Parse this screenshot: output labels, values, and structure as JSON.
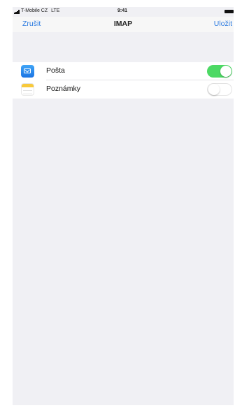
{
  "status_bar": {
    "carrier": "T-Mobile CZ",
    "network": "LTE",
    "time": "9:41"
  },
  "nav": {
    "cancel_label": "Zrušit",
    "title": "IMAP",
    "save_label": "Uložit"
  },
  "accent_color": "#2f7de1",
  "toggle_on_color": "#4cd964",
  "items": [
    {
      "label": "Pošta",
      "icon": "mail-icon",
      "enabled": true
    },
    {
      "label": "Poznámky",
      "icon": "notes-icon",
      "enabled": false
    }
  ]
}
